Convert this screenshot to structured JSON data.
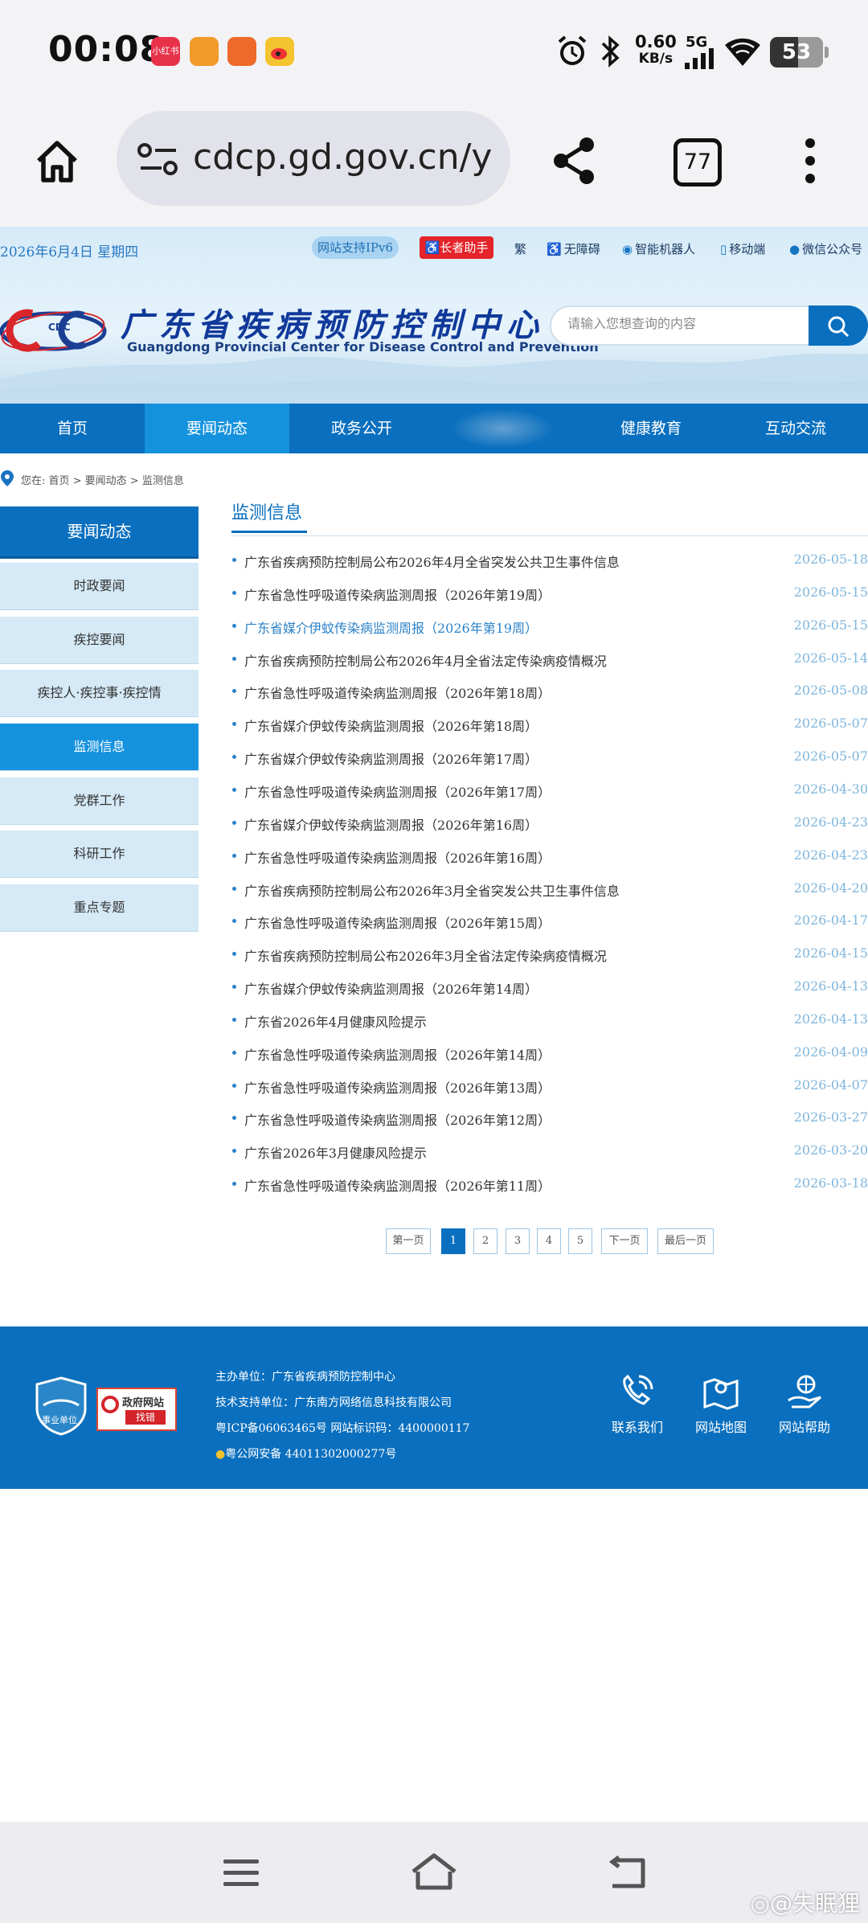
{
  "status_bar": {
    "time": "00:08",
    "app_badge_1_label": "小红书",
    "net_speed_value": "0.60",
    "net_speed_unit": "KB/s",
    "network_type": "5G",
    "battery": "53",
    "battery_level_percent": 53
  },
  "browser": {
    "url": "cdcp.gd.gov.cn/y",
    "tab_count": "77"
  },
  "top_strip": {
    "date": "2026年6月4日  星期四",
    "ipv6": "网站支持IPv6",
    "elder_mode": "长者助手",
    "traditional": "繁",
    "accessibility": "无障碍",
    "robot": "智能机器人",
    "mobile": "移动端",
    "wechat": "微信公众号"
  },
  "logo": {
    "abbr": "CDC",
    "cn": "广东省疾病预防控制中心",
    "en": "Guangdong Provincial Center for Disease Control and Prevention"
  },
  "search": {
    "placeholder": "请输入您想查询的内容"
  },
  "nav": {
    "items": [
      {
        "label": "首页"
      },
      {
        "label": "要闻动态"
      },
      {
        "label": "政务公开"
      },
      {
        "label": ""
      },
      {
        "label": "健康教育"
      },
      {
        "label": "互动交流"
      }
    ],
    "active_index": 1
  },
  "breadcrumb": {
    "text": "您在: 首页 > 要闻动态 > 监测信息"
  },
  "sidebar": {
    "title": "要闻动态",
    "items": [
      {
        "label": "时政要闻"
      },
      {
        "label": "疾控要闻"
      },
      {
        "label": "疾控人·疾控事·疾控情"
      },
      {
        "label": "监测信息"
      },
      {
        "label": "党群工作"
      },
      {
        "label": "科研工作"
      },
      {
        "label": "重点专题"
      }
    ],
    "active_index": 3
  },
  "list": {
    "title": "监测信息",
    "items": [
      {
        "title": "广东省疾病预防控制局公布2026年4月全省突发公共卫生事件信息",
        "date": "2026-05-18"
      },
      {
        "title": "广东省急性呼吸道传染病监测周报（2026年第19周）",
        "date": "2026-05-15"
      },
      {
        "title": "广东省媒介伊蚊传染病监测周报（2026年第19周）",
        "date": "2026-05-15"
      },
      {
        "title": "广东省疾病预防控制局公布2026年4月全省法定传染病疫情概况",
        "date": "2026-05-14"
      },
      {
        "title": "广东省急性呼吸道传染病监测周报（2026年第18周）",
        "date": "2026-05-08"
      },
      {
        "title": "广东省媒介伊蚊传染病监测周报（2026年第18周）",
        "date": "2026-05-07"
      },
      {
        "title": "广东省媒介伊蚊传染病监测周报（2026年第17周）",
        "date": "2026-05-07"
      },
      {
        "title": "广东省急性呼吸道传染病监测周报（2026年第17周）",
        "date": "2026-04-30"
      },
      {
        "title": "广东省媒介伊蚊传染病监测周报（2026年第16周）",
        "date": "2026-04-23"
      },
      {
        "title": "广东省急性呼吸道传染病监测周报（2026年第16周）",
        "date": "2026-04-23"
      },
      {
        "title": "广东省疾病预防控制局公布2026年3月全省突发公共卫生事件信息",
        "date": "2026-04-20"
      },
      {
        "title": "广东省急性呼吸道传染病监测周报（2026年第15周）",
        "date": "2026-04-17"
      },
      {
        "title": "广东省疾病预防控制局公布2026年3月全省法定传染病疫情概况",
        "date": "2026-04-15"
      },
      {
        "title": "广东省媒介伊蚊传染病监测周报（2026年第14周）",
        "date": "2026-04-13"
      },
      {
        "title": "广东省2026年4月健康风险提示",
        "date": "2026-04-13"
      },
      {
        "title": "广东省急性呼吸道传染病监测周报（2026年第14周）",
        "date": "2026-04-09"
      },
      {
        "title": "广东省急性呼吸道传染病监测周报（2026年第13周）",
        "date": "2026-04-07"
      },
      {
        "title": "广东省急性呼吸道传染病监测周报（2026年第12周）",
        "date": "2026-03-27"
      },
      {
        "title": "广东省2026年3月健康风险提示",
        "date": "2026-03-20"
      },
      {
        "title": "广东省急性呼吸道传染病监测周报（2026年第11周）",
        "date": "2026-03-18"
      }
    ],
    "highlight_index": 2
  },
  "pager": {
    "first": "第一页",
    "pages": [
      "1",
      "2",
      "3",
      "4",
      "5"
    ],
    "current": "1",
    "next": "下一页",
    "last": "最后一页"
  },
  "footer": {
    "shield_label": "事业单位",
    "gov_badge_line1": "政府网站",
    "gov_badge_line2": "找错",
    "sponsor": "主办单位：广东省疾病预防控制中心",
    "tech_support": "技术支持单位：广东南方网络信息科技有限公司",
    "icp": "粤ICP备06063465号  网站标识码：4400000117",
    "police": "粤公网安备 44011302000277号",
    "links": [
      {
        "label": "联系我们",
        "icon": "phone-icon"
      },
      {
        "label": "网站地图",
        "icon": "map-icon"
      },
      {
        "label": "网站帮助",
        "icon": "help-icon"
      }
    ]
  },
  "watermark": "@失眠狸",
  "colors": {
    "brand_blue": "#0a6fbe",
    "active_blue": "#1592de",
    "sidebar_light": "#d5e9f6",
    "date_blue": "#7fb5db",
    "alert_red": "#e4242a"
  }
}
